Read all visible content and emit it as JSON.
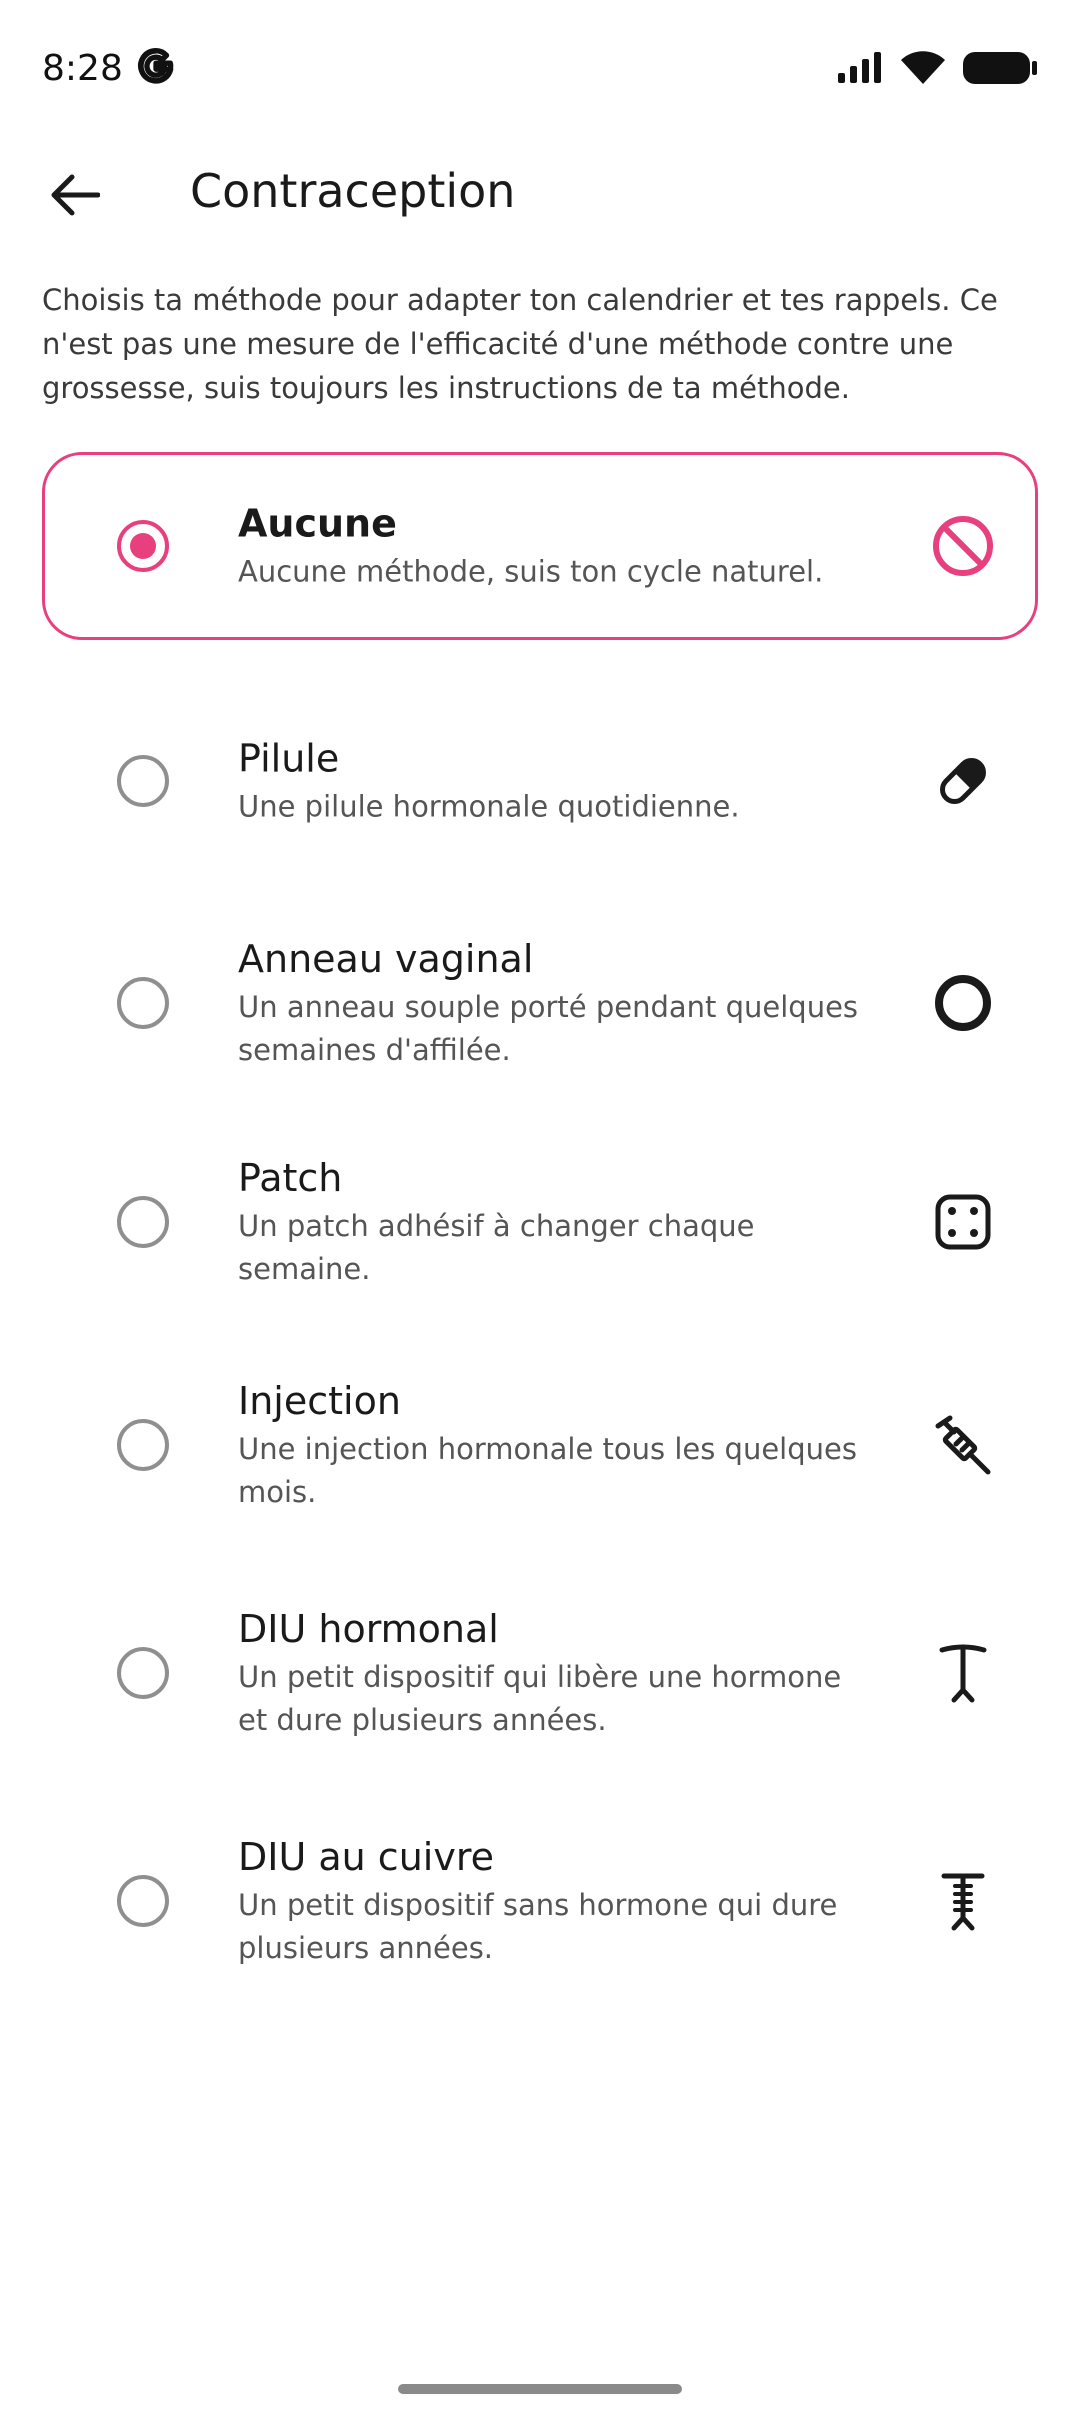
{
  "status": {
    "time": "8:28"
  },
  "header": {
    "title": "Contraception"
  },
  "description": "Choisis ta méthode pour adapter ton calendrier et tes rappels. Ce n'est pas une mesure de l'efficacité d'une méthode contre une grossesse,  suis toujours les instructions de ta méthode.",
  "options": [
    {
      "title": "Aucune",
      "subtitle": "Aucune méthode,  suis ton cycle naturel.",
      "icon": "no-sign-icon",
      "selected": true
    },
    {
      "title": "Pilule",
      "subtitle": "Une pilule hormonale quotidienne.",
      "icon": "pill-icon",
      "selected": false
    },
    {
      "title": "Anneau vaginal",
      "subtitle": "Un anneau souple porté pendant quelques semaines d'affilée.",
      "icon": "ring-icon",
      "selected": false
    },
    {
      "title": "Patch",
      "subtitle": "Un patch adhésif à changer chaque semaine.",
      "icon": "patch-icon",
      "selected": false
    },
    {
      "title": "Injection",
      "subtitle": "Une injection hormonale tous les quelques mois.",
      "icon": "syringe-icon",
      "selected": false
    },
    {
      "title": "DIU hormonal",
      "subtitle": "Un petit dispositif qui libère une hormone et dure plusieurs années.",
      "icon": "hormonal-iud-icon",
      "selected": false
    },
    {
      "title": "DIU au cuivre",
      "subtitle": "Un petit dispositif sans hormone qui dure plusieurs années.",
      "icon": "copper-iud-icon",
      "selected": false
    }
  ],
  "colors": {
    "accent": "#e8407f"
  }
}
